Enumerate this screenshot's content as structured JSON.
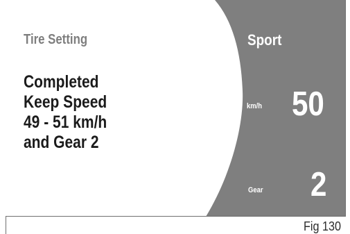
{
  "screen": {
    "title": "Tire Setting",
    "message_lines": [
      "Completed",
      "Keep Speed",
      "49 - 51 km/h",
      "and Gear 2"
    ],
    "mode": "Sport",
    "speed": {
      "unit": "km/h",
      "value": "50"
    },
    "gear": {
      "label": "Gear",
      "value": "2"
    }
  },
  "figure_label": "Fig 130",
  "colors": {
    "panel": "#7f7f7f",
    "title": "#7e7e7e",
    "text": "#1b1b1b",
    "panel_text": "#ffffff",
    "frame": "#6f6f6f"
  }
}
